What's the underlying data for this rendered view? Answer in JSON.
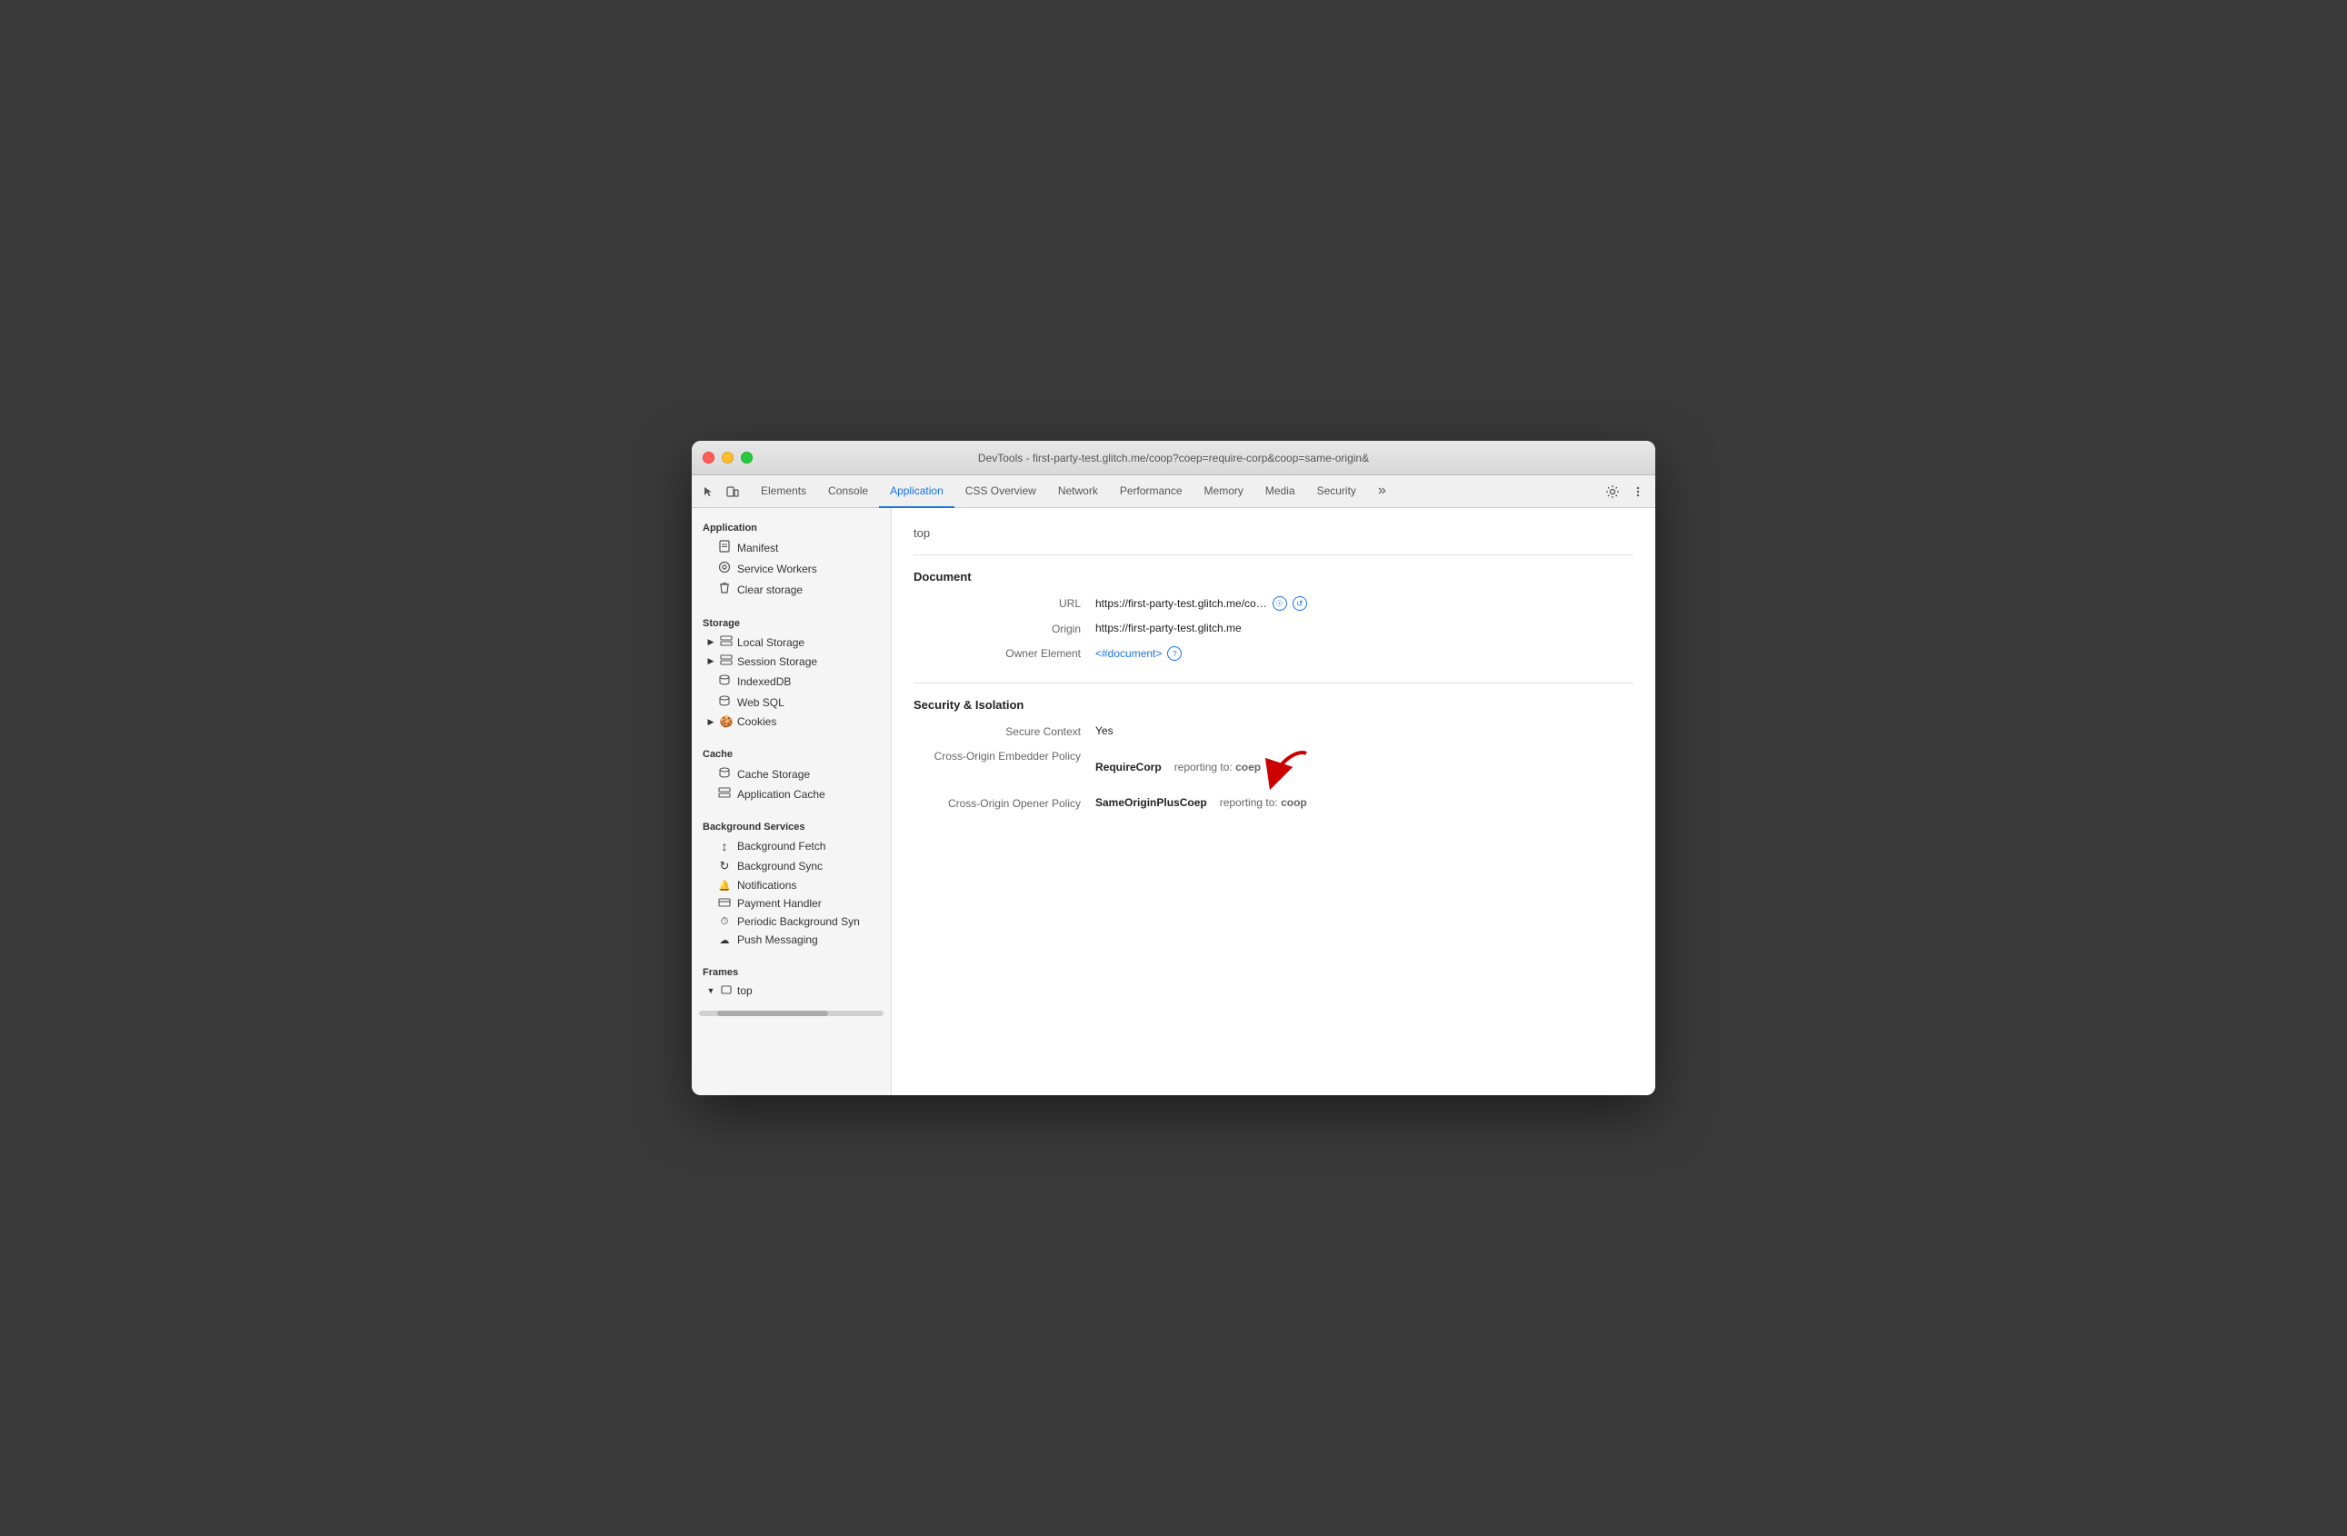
{
  "window": {
    "title": "DevTools - first-party-test.glitch.me/coop?coep=require-corp&coop=same-origin&"
  },
  "tabs": [
    {
      "id": "elements",
      "label": "Elements",
      "active": false
    },
    {
      "id": "console",
      "label": "Console",
      "active": false
    },
    {
      "id": "application",
      "label": "Application",
      "active": true
    },
    {
      "id": "css-overview",
      "label": "CSS Overview",
      "active": false
    },
    {
      "id": "network",
      "label": "Network",
      "active": false
    },
    {
      "id": "performance",
      "label": "Performance",
      "active": false
    },
    {
      "id": "memory",
      "label": "Memory",
      "active": false
    },
    {
      "id": "media",
      "label": "Media",
      "active": false
    },
    {
      "id": "security",
      "label": "Security",
      "active": false
    }
  ],
  "sidebar": {
    "sections": [
      {
        "label": "Application",
        "items": [
          {
            "id": "manifest",
            "icon": "📄",
            "label": "Manifest"
          },
          {
            "id": "service-workers",
            "icon": "⚙️",
            "label": "Service Workers"
          },
          {
            "id": "clear-storage",
            "icon": "🗑️",
            "label": "Clear storage"
          }
        ]
      },
      {
        "label": "Storage",
        "items": [
          {
            "id": "local-storage",
            "icon": "▶ ▦",
            "label": "Local Storage",
            "expandable": true
          },
          {
            "id": "session-storage",
            "icon": "▶ ▦",
            "label": "Session Storage",
            "expandable": true
          },
          {
            "id": "indexeddb",
            "icon": "🗄️",
            "label": "IndexedDB"
          },
          {
            "id": "web-sql",
            "icon": "🗄️",
            "label": "Web SQL"
          },
          {
            "id": "cookies",
            "icon": "▶ 🍪",
            "label": "Cookies",
            "expandable": true
          }
        ]
      },
      {
        "label": "Cache",
        "items": [
          {
            "id": "cache-storage",
            "icon": "🗄️",
            "label": "Cache Storage"
          },
          {
            "id": "application-cache",
            "icon": "▦",
            "label": "Application Cache"
          }
        ]
      },
      {
        "label": "Background Services",
        "items": [
          {
            "id": "background-fetch",
            "icon": "↕",
            "label": "Background Fetch"
          },
          {
            "id": "background-sync",
            "icon": "↻",
            "label": "Background Sync"
          },
          {
            "id": "notifications",
            "icon": "🔔",
            "label": "Notifications"
          },
          {
            "id": "payment-handler",
            "icon": "▭",
            "label": "Payment Handler"
          },
          {
            "id": "periodic-bg-sync",
            "icon": "⏱",
            "label": "Periodic Background Syn"
          },
          {
            "id": "push-messaging",
            "icon": "☁",
            "label": "Push Messaging"
          }
        ]
      },
      {
        "label": "Frames",
        "items": [
          {
            "id": "top-frame",
            "icon": "▼ ▭",
            "label": "top",
            "expandable": true
          }
        ]
      }
    ]
  },
  "content": {
    "top_label": "top",
    "sections": [
      {
        "id": "document",
        "title": "Document",
        "fields": [
          {
            "label": "URL",
            "value": "https://first-party-test.glitch.me/co…",
            "has_icons": true,
            "icons": [
              "link-icon",
              "reload-icon"
            ]
          },
          {
            "label": "Origin",
            "value": "https://first-party-test.glitch.me",
            "has_icons": false
          },
          {
            "label": "Owner Element",
            "value": "<#document>",
            "is_link": true,
            "has_info_icon": true
          }
        ]
      },
      {
        "id": "security-isolation",
        "title": "Security & Isolation",
        "fields": [
          {
            "label": "Secure Context",
            "value": "Yes"
          },
          {
            "label": "Cross-Origin Embedder Policy",
            "value": "RequireCorp",
            "extra": "reporting to:",
            "extra_value": "coep",
            "has_red_arrow": true
          },
          {
            "label": "Cross-Origin Opener Policy",
            "value": "SameOriginPlusCoep",
            "extra": "reporting to:",
            "extra_value": "coop"
          }
        ]
      }
    ]
  }
}
